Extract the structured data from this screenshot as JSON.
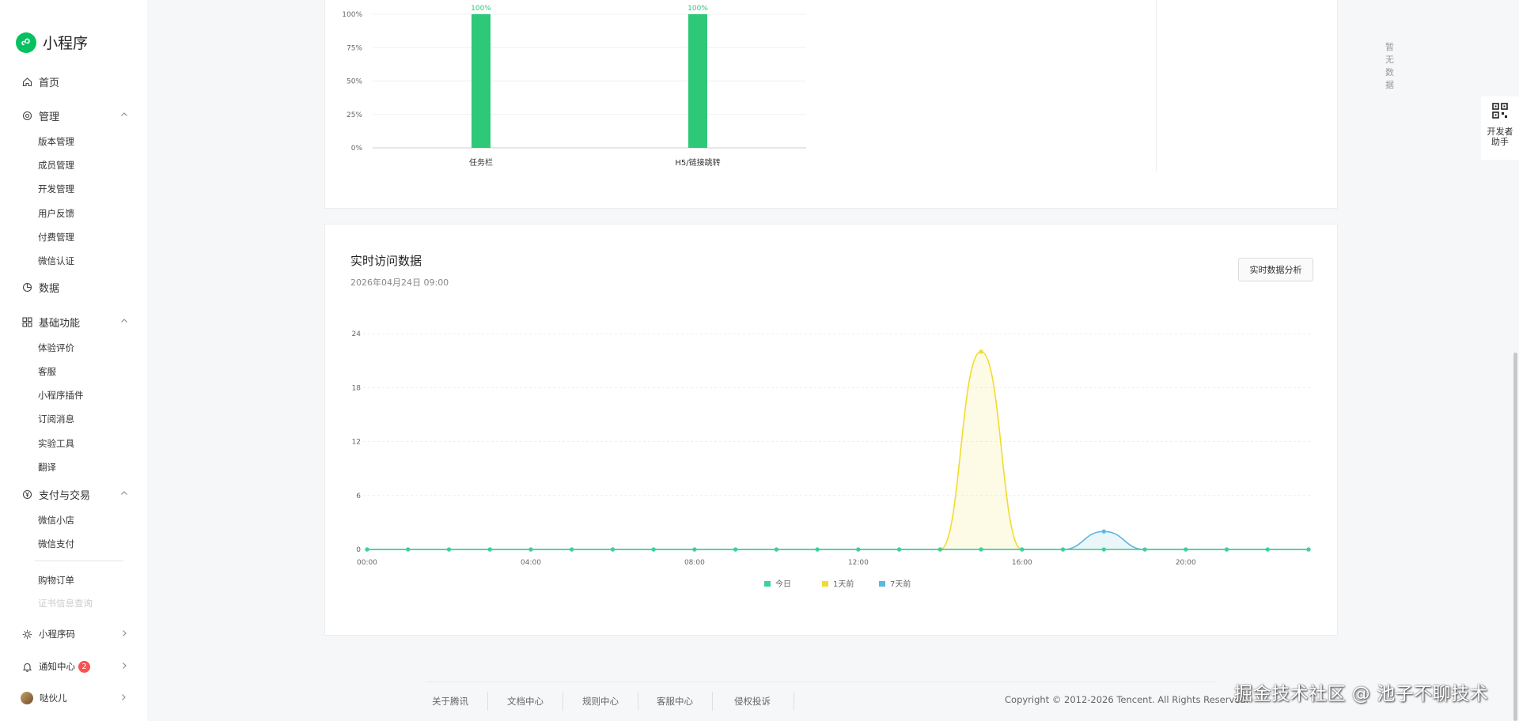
{
  "sidebar": {
    "brand": "小程序",
    "home": "首页",
    "manage": {
      "label": "管理",
      "items": [
        "版本管理",
        "成员管理",
        "开发管理",
        "用户反馈",
        "付费管理",
        "微信认证"
      ]
    },
    "data": "数据",
    "basic": {
      "label": "基础功能",
      "items": [
        "体验评价",
        "客服",
        "小程序插件",
        "订阅消息",
        "实验工具",
        "翻译"
      ]
    },
    "pay": {
      "label": "支付与交易",
      "items": [
        "微信小店",
        "微信支付"
      ],
      "extra": "购物订单",
      "faded": "证书信息查询"
    },
    "qrcode": "小程序码",
    "notify": "通知中心",
    "notify_count": "2",
    "user": "哒伙儿"
  },
  "top_card": {
    "empty_text": "暂无数据"
  },
  "realtime": {
    "title": "实时访问数据",
    "date": "2026年04月24日 09:00",
    "button": "实时数据分析"
  },
  "chart_data": [
    {
      "type": "bar",
      "categories": [
        "任务栏",
        "H5/链接跳转"
      ],
      "values": [
        100,
        100
      ],
      "value_labels": [
        "100%",
        "100%"
      ],
      "ytick_labels": [
        "0%",
        "25%",
        "50%",
        "75%",
        "100%"
      ],
      "ylim": [
        0,
        100
      ],
      "color": "#2dc878"
    },
    {
      "type": "line",
      "x": [
        "00:00",
        "01:00",
        "02:00",
        "03:00",
        "04:00",
        "05:00",
        "06:00",
        "07:00",
        "08:00",
        "09:00",
        "10:00",
        "11:00",
        "12:00",
        "13:00",
        "14:00",
        "15:00",
        "16:00",
        "17:00",
        "18:00",
        "19:00",
        "20:00",
        "21:00",
        "22:00",
        "23:00"
      ],
      "xtick_labels": [
        "00:00",
        "04:00",
        "08:00",
        "12:00",
        "16:00",
        "20:00"
      ],
      "yticks": [
        0,
        6,
        12,
        18,
        24
      ],
      "ylim": [
        0,
        24
      ],
      "series": [
        {
          "name": "今日",
          "color": "#3fcf9f",
          "values": [
            0,
            0,
            0,
            0,
            0,
            0,
            0,
            0,
            0,
            0,
            0,
            0,
            0,
            0,
            0,
            0,
            0,
            0,
            0,
            0,
            0,
            0,
            0,
            0
          ]
        },
        {
          "name": "1天前",
          "color": "#f0dc2e",
          "values": [
            0,
            0,
            0,
            0,
            0,
            0,
            0,
            0,
            0,
            0,
            0,
            0,
            0,
            0,
            0,
            22,
            0,
            0,
            0,
            0,
            0,
            0,
            0,
            0
          ]
        },
        {
          "name": "7天前",
          "color": "#5ab7e0",
          "values": [
            0,
            0,
            0,
            0,
            0,
            0,
            0,
            0,
            0,
            0,
            0,
            0,
            0,
            0,
            0,
            0,
            0,
            0,
            2,
            0,
            0,
            0,
            0,
            0
          ]
        }
      ],
      "grid": true,
      "legend": "bottom"
    }
  ],
  "footer": {
    "links": [
      "关于腾讯",
      "文档中心",
      "规则中心",
      "客服中心",
      "侵权投诉"
    ],
    "copyright": "Copyright © 2012-2026 Tencent. All Rights Reserved."
  },
  "helper": {
    "label": "开发者助手"
  },
  "watermark": "掘金技术社区 @ 池子不聊技术"
}
